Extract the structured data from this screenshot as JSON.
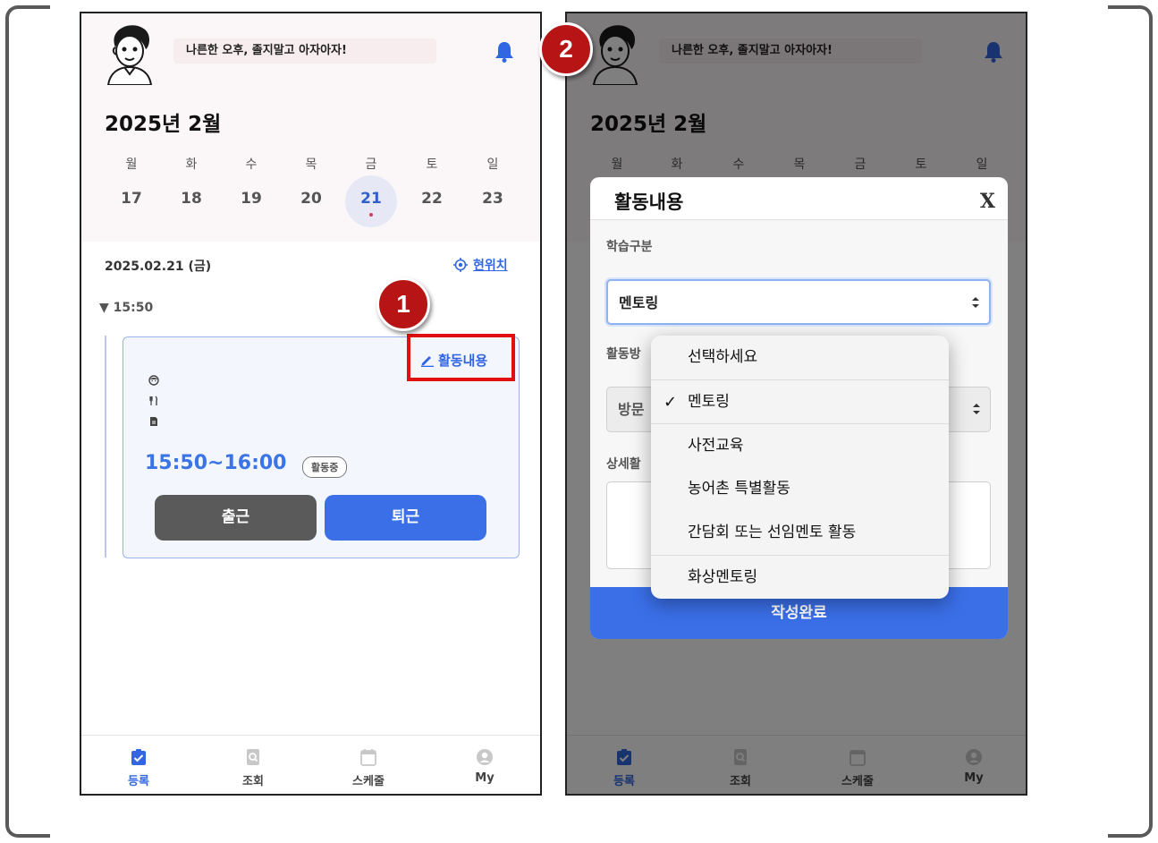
{
  "callouts": {
    "first": "1",
    "second": "2"
  },
  "header": {
    "greeting": "나른한 오후, 졸지말고 아자아자!"
  },
  "calendar": {
    "month_title": "2025년 2월",
    "weekdays": [
      "월",
      "화",
      "수",
      "목",
      "금",
      "토",
      "일"
    ],
    "days": [
      "17",
      "18",
      "19",
      "20",
      "21",
      "22",
      "23"
    ],
    "selected_day": "21"
  },
  "schedule": {
    "date_label": "2025.02.21 (금)",
    "location_link": "현위치",
    "time_group": "15:50",
    "card": {
      "edit_link": "활동내용",
      "time_range": "15:50~16:00",
      "status_badge": "활동중",
      "check_in": "출근",
      "check_out": "퇴근"
    }
  },
  "bottom_nav": [
    {
      "label": "등록",
      "icon": "clipboard-check-icon",
      "active": true
    },
    {
      "label": "조회",
      "icon": "search-document-icon",
      "active": false
    },
    {
      "label": "스케줄",
      "icon": "calendar-icon",
      "active": false
    },
    {
      "label": "My",
      "icon": "user-circle-icon",
      "active": false
    }
  ],
  "modal": {
    "title": "활동내용",
    "close": "X",
    "study_type_label": "학습구분",
    "study_type_value": "멘토링",
    "activity_method_label": "활동방",
    "activity_method_value": "방문",
    "detail_label": "상세활",
    "submit": "작성완료"
  },
  "dropdown": {
    "options": [
      "선택하세요",
      "멘토링",
      "사전교육",
      "농어촌 특별활동",
      "간담회 또는 선임멘토 활동",
      "화상멘토링"
    ],
    "selected": "멘토링",
    "check_mark": "✓"
  },
  "colors": {
    "accent": "#3a6fe8",
    "callout_red": "#b71515",
    "highlight_red": "#e01010",
    "selected_dot": "#d63b5c"
  }
}
